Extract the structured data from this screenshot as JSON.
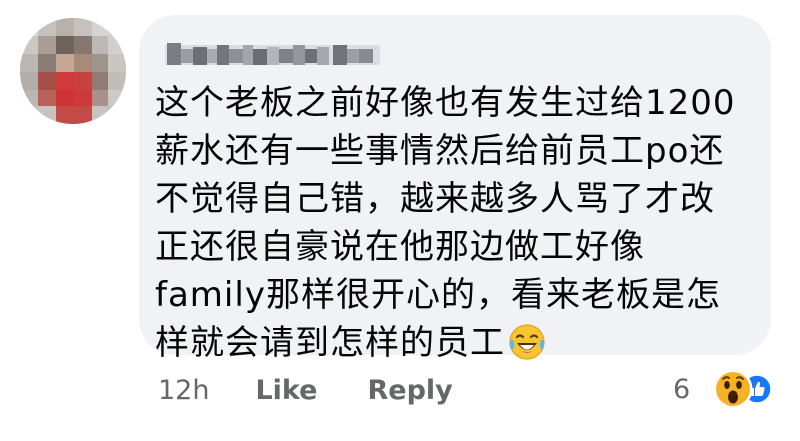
{
  "comment": {
    "author_name": "EngWarsiaAha",
    "lines": [
      "这个老板之前好像也有发生过给1200",
      "薪水还有一些事情然后给前员工po还",
      "不觉得自己错，越来越多人骂了才改",
      "正还很自豪说在他那边做工好像",
      "family那样很开心的，看来老板是怎",
      "样就会请到怎样的员工"
    ],
    "trailing_emoji": "laughing-crying-emoji"
  },
  "actions": {
    "timestamp": "12h",
    "like_label": "Like",
    "reply_label": "Reply"
  },
  "reactions": {
    "count": "6",
    "types": [
      "wow",
      "like"
    ]
  },
  "colors": {
    "bubble_bg": "#f0f2f5",
    "text": "#050505",
    "secondary_text": "#65676b",
    "like_blue": "#1877f2",
    "reaction_yellow": "#f7b125"
  }
}
